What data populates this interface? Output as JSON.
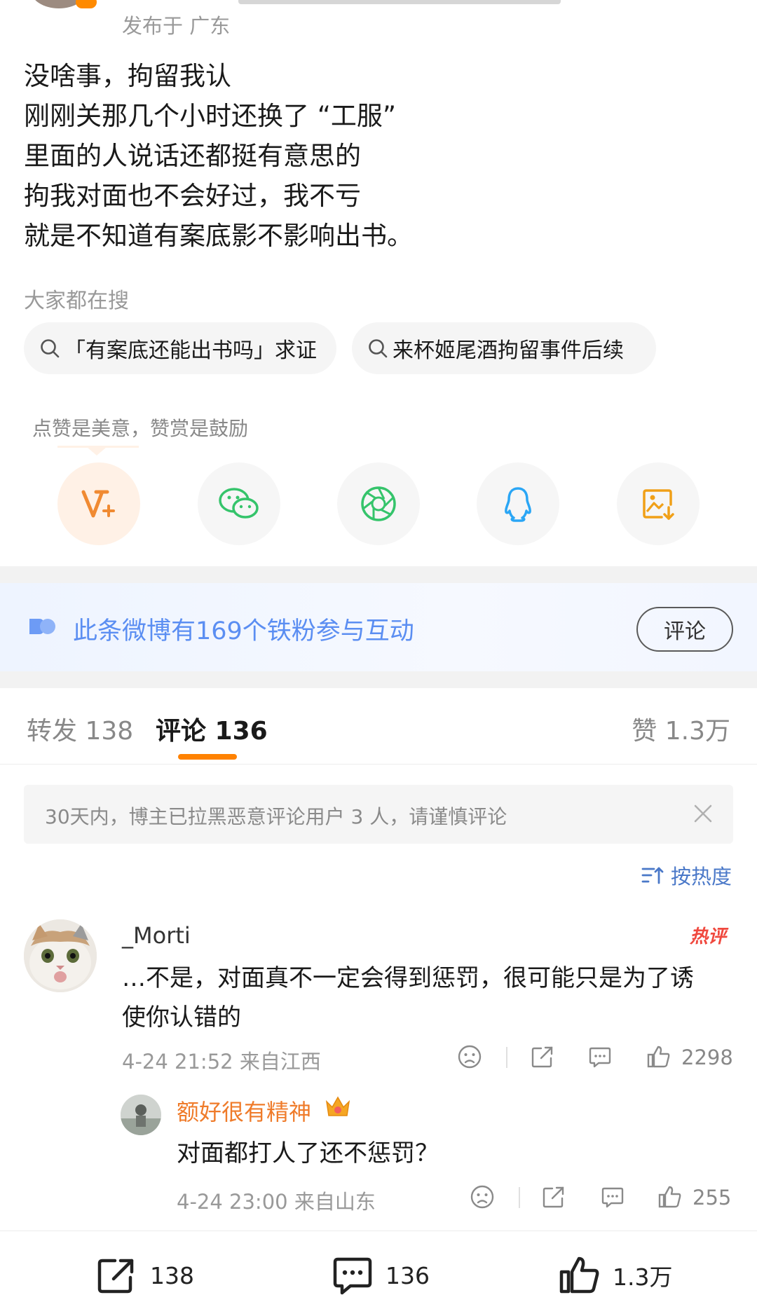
{
  "post": {
    "meta": "发布于 广东",
    "lines": [
      "没啥事，拘留我认",
      "刚刚关那几个小时还换了 “工服”",
      "里面的人说话还都挺有意思的",
      "拘我对面也不会好过，我不亏",
      "就是不知道有案底影不影响出书。"
    ]
  },
  "search": {
    "title": "大家都在搜",
    "chips": [
      "「有案底还能出书吗」求证",
      "来杯姬尾酒拘留事件后续"
    ]
  },
  "reward_tip": "点赞是美意，赞赏是鼓励",
  "share": [
    {
      "name": "vip-reward-icon",
      "color": "#f08a32"
    },
    {
      "name": "wechat-icon",
      "color": "#35c46b"
    },
    {
      "name": "moments-icon",
      "color": "#35c46b"
    },
    {
      "name": "qq-icon",
      "color": "#2aa6f5"
    },
    {
      "name": "save-image-icon",
      "color": "#f0a018"
    }
  ],
  "fans_banner": {
    "text": "此条微博有169个铁粉参与互动",
    "button": "评论"
  },
  "tabs": {
    "repost": "转发 138",
    "comments": "评论 136",
    "likes": "赞 1.3万"
  },
  "notice": "30天内，博主已拉黑恶意评论用户 3 人，请谨慎评论",
  "sort_label": "按热度",
  "comment": {
    "user": "_Morti",
    "badge": "热评",
    "lines": [
      "…不是，对面真不一定会得到惩罚，很可能只是为了诱",
      "使你认错的"
    ],
    "time": "4-24 21:52 来自江西",
    "likes": "2298"
  },
  "reply": {
    "user": "额好很有精神",
    "text": "对面都打人了还不惩罚？",
    "time": "4-24 23:00 来自山东",
    "likes": "255"
  },
  "bottom_bar": {
    "repost": "138",
    "comment": "136",
    "like": "1.3万"
  },
  "colors": {
    "accent_orange": "#ff8200",
    "link_blue": "#4a78c8",
    "reply_name": "#ef7b2a",
    "hot_red": "#f0483e"
  }
}
